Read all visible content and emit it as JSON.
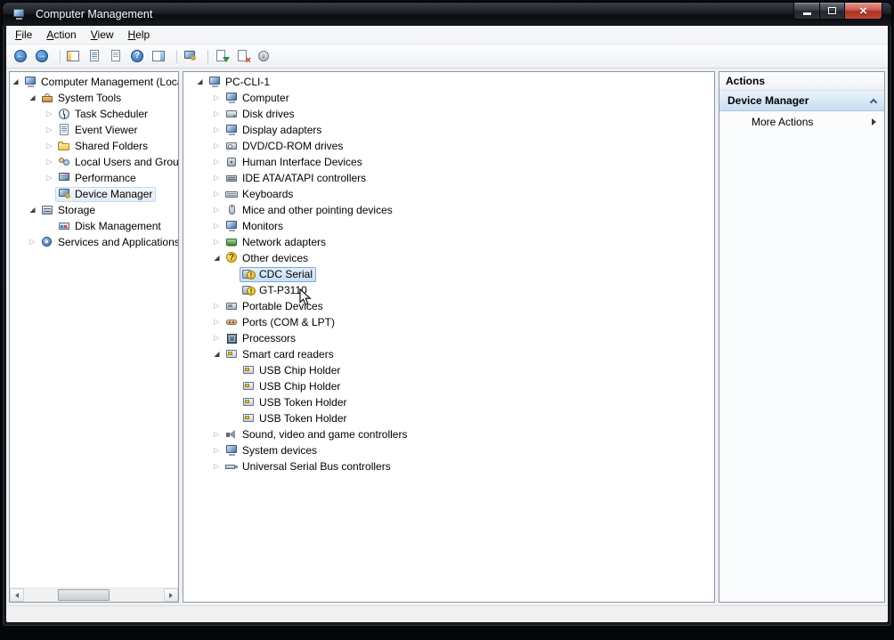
{
  "window": {
    "title": "Computer Management",
    "status_text": ""
  },
  "menu": {
    "items": [
      "File",
      "Action",
      "View",
      "Help"
    ]
  },
  "toolbar": {
    "buttons": [
      {
        "icon": "back-icon"
      },
      {
        "icon": "forward-icon"
      },
      {
        "icon": "show-hide-console-tree-icon",
        "sep": true
      },
      {
        "icon": "export-list-icon"
      },
      {
        "icon": "properties-icon"
      },
      {
        "icon": "help-icon"
      },
      {
        "icon": "show-hide-action-pane-icon"
      },
      {
        "icon": "scan-hardware-changes-icon",
        "sep": true
      },
      {
        "icon": "update-driver-icon",
        "sep": true
      },
      {
        "icon": "uninstall-device-icon"
      },
      {
        "icon": "disable-device-icon"
      }
    ]
  },
  "console_tree": {
    "items": [
      {
        "label": "Computer Management (Local",
        "icon": "computer-management-icon",
        "indent": 0,
        "expand": "open"
      },
      {
        "label": "System Tools",
        "icon": "system-tools-icon",
        "indent": 1,
        "expand": "open"
      },
      {
        "label": "Task Scheduler",
        "icon": "task-scheduler-icon",
        "indent": 2,
        "expand": "closed"
      },
      {
        "label": "Event Viewer",
        "icon": "event-viewer-icon",
        "indent": 2,
        "expand": "closed"
      },
      {
        "label": "Shared Folders",
        "icon": "shared-folders-icon",
        "indent": 2,
        "expand": "closed"
      },
      {
        "label": "Local Users and Groups",
        "icon": "users-groups-icon",
        "indent": 2,
        "expand": "closed"
      },
      {
        "label": "Performance",
        "icon": "performance-icon",
        "indent": 2,
        "expand": "closed"
      },
      {
        "label": "Device Manager",
        "icon": "device-manager-icon",
        "indent": 2,
        "expand": "none",
        "subtle": true
      },
      {
        "label": "Storage",
        "icon": "storage-icon",
        "indent": 1,
        "expand": "open"
      },
      {
        "label": "Disk Management",
        "icon": "disk-management-icon",
        "indent": 2,
        "expand": "none"
      },
      {
        "label": "Services and Applications",
        "icon": "services-icon",
        "indent": 1,
        "expand": "closed"
      }
    ]
  },
  "device_tree": {
    "items": [
      {
        "label": "PC-CLI-1",
        "icon": "computer-icon",
        "indent": 0,
        "expand": "open"
      },
      {
        "label": "Computer",
        "icon": "computer-icon",
        "indent": 1,
        "expand": "closed"
      },
      {
        "label": "Disk drives",
        "icon": "disk-drive-icon",
        "indent": 1,
        "expand": "closed"
      },
      {
        "label": "Display adapters",
        "icon": "display-adapter-icon",
        "indent": 1,
        "expand": "closed"
      },
      {
        "label": "DVD/CD-ROM drives",
        "icon": "cd-drive-icon",
        "indent": 1,
        "expand": "closed"
      },
      {
        "label": "Human Interface Devices",
        "icon": "hid-icon",
        "indent": 1,
        "expand": "closed"
      },
      {
        "label": "IDE ATA/ATAPI controllers",
        "icon": "ide-controller-icon",
        "indent": 1,
        "expand": "closed"
      },
      {
        "label": "Keyboards",
        "icon": "keyboard-icon",
        "indent": 1,
        "expand": "closed"
      },
      {
        "label": "Mice and other pointing devices",
        "icon": "mouse-icon",
        "indent": 1,
        "expand": "closed"
      },
      {
        "label": "Monitors",
        "icon": "monitor-icon",
        "indent": 1,
        "expand": "closed"
      },
      {
        "label": "Network adapters",
        "icon": "network-adapter-icon",
        "indent": 1,
        "expand": "closed"
      },
      {
        "label": "Other devices",
        "icon": "other-devices-icon",
        "indent": 1,
        "expand": "open"
      },
      {
        "label": "CDC Serial",
        "icon": "unknown-device-warning-icon",
        "indent": 2,
        "expand": "none",
        "selected": true
      },
      {
        "label": "GT-P3110",
        "icon": "unknown-device-warning-icon",
        "indent": 2,
        "expand": "none"
      },
      {
        "label": "Portable Devices",
        "icon": "portable-device-icon",
        "indent": 1,
        "expand": "closed"
      },
      {
        "label": "Ports (COM & LPT)",
        "icon": "ports-icon",
        "indent": 1,
        "expand": "closed"
      },
      {
        "label": "Processors",
        "icon": "processor-icon",
        "indent": 1,
        "expand": "closed"
      },
      {
        "label": "Smart card readers",
        "icon": "smart-card-reader-icon",
        "indent": 1,
        "expand": "open"
      },
      {
        "label": "USB Chip Holder",
        "icon": "smart-card-reader-icon",
        "indent": 2,
        "expand": "none"
      },
      {
        "label": "USB Chip Holder",
        "icon": "smart-card-reader-icon",
        "indent": 2,
        "expand": "none"
      },
      {
        "label": "USB Token Holder",
        "icon": "smart-card-reader-icon",
        "indent": 2,
        "expand": "none"
      },
      {
        "label": "USB Token Holder",
        "icon": "smart-card-reader-icon",
        "indent": 2,
        "expand": "none"
      },
      {
        "label": "Sound, video and game controllers",
        "icon": "sound-icon",
        "indent": 1,
        "expand": "closed"
      },
      {
        "label": "System devices",
        "icon": "system-devices-icon",
        "indent": 1,
        "expand": "closed"
      },
      {
        "label": "Universal Serial Bus controllers",
        "icon": "usb-controller-icon",
        "indent": 1,
        "expand": "closed"
      }
    ]
  },
  "actions_pane": {
    "title": "Actions",
    "sections": [
      {
        "label": "Device Manager",
        "chevron": "up"
      },
      {
        "label": "More Actions",
        "chevron": "right"
      }
    ]
  },
  "colors": {
    "selection_fill": "#c6def7",
    "selection_border": "#7da7d9",
    "warning_yellow": "#efb300",
    "titlebar": "#15181e",
    "close_button_red": "#c1473a",
    "pane_border": "#8b98a6"
  }
}
